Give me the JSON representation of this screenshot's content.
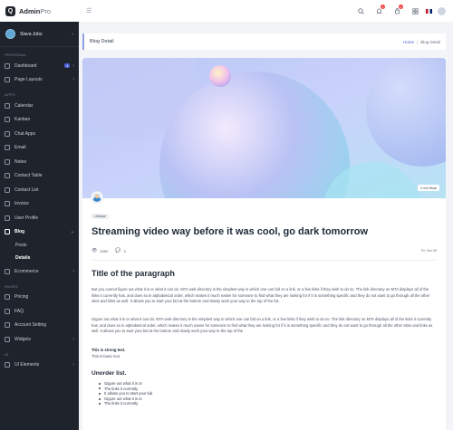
{
  "brand": {
    "name": "Admin",
    "suffix": "Pro",
    "logo_letter": "Q"
  },
  "profile": {
    "name": "Slava Jobs"
  },
  "sidebar": {
    "sections": {
      "personal": "PERSONAL",
      "apps": "APPS",
      "pages": "PAGES",
      "ui": "UI"
    },
    "personal_items": [
      {
        "label": "Dashboard",
        "badge": "4"
      },
      {
        "label": "Page Layouts"
      }
    ],
    "apps_items": [
      {
        "label": "Calendar"
      },
      {
        "label": "Kanban"
      },
      {
        "label": "Chat Apps"
      },
      {
        "label": "Email"
      },
      {
        "label": "Notes"
      },
      {
        "label": "Contact Table"
      },
      {
        "label": "Contact List"
      },
      {
        "label": "Invoice"
      },
      {
        "label": "User Profile"
      },
      {
        "label": "Blog"
      }
    ],
    "blog_sub": [
      {
        "label": "Posts"
      },
      {
        "label": "Details"
      }
    ],
    "after_blog": [
      {
        "label": "Ecommerce"
      }
    ],
    "pages_items": [
      {
        "label": "Pricing"
      },
      {
        "label": "FAQ"
      },
      {
        "label": "Account Setting"
      },
      {
        "label": "Widgets"
      }
    ],
    "ui_items": [
      {
        "label": "UI Elements"
      }
    ]
  },
  "topbar": {
    "badges": {
      "notifications": "4",
      "cart": "3"
    }
  },
  "page_header": {
    "title": "Blog Detail",
    "breadcrumb": {
      "home": "Home",
      "current": "Blog Detail"
    }
  },
  "post": {
    "read_time": "2 min Read",
    "tag": "Lifestyle",
    "title": "Streaming video way before it was cool, go dark tomorrow",
    "views": "3292",
    "comments": "3",
    "date": "Fri, Dec 05",
    "section_title": "Title of the paragraph",
    "paragraph_1": "But you cannot figure out what it is or what it can do. MTA web directory is the simplest way in which one can bid on a link, or a few links if they wish to do so. The link directory on MTA displays all of the links it currently has, and does so in alphabetical order, which makes it much easier for someone to find what they are looking for if it is something specific and they do not want to go through all the other sites and links as well. It allows you to start your bid at the bottom and slowly work your way to the top of the list.",
    "paragraph_2": "Gigure out what it is or what it can do. MTA web directory is the simplest way in which one can bid on a link, or a few links if they wish to do so. The link directory on MTA displays all of the links it currently has, and does so in alphabetical order, which makes it much easier for someone to find what they are looking for if it is something specific and they do not want to go through all the other sites and links as well. It allows you to start your bid at the bottom and slowly work your way to the top of the",
    "strong_text": "This is strong text.",
    "basic_text": "This is basic text.",
    "list_title": "Unorder list.",
    "list_items": [
      "Gigure out what it is or",
      "The links it currently",
      "It allows you to start your bid",
      "Gigure out what it is or",
      "The links it currently"
    ]
  }
}
